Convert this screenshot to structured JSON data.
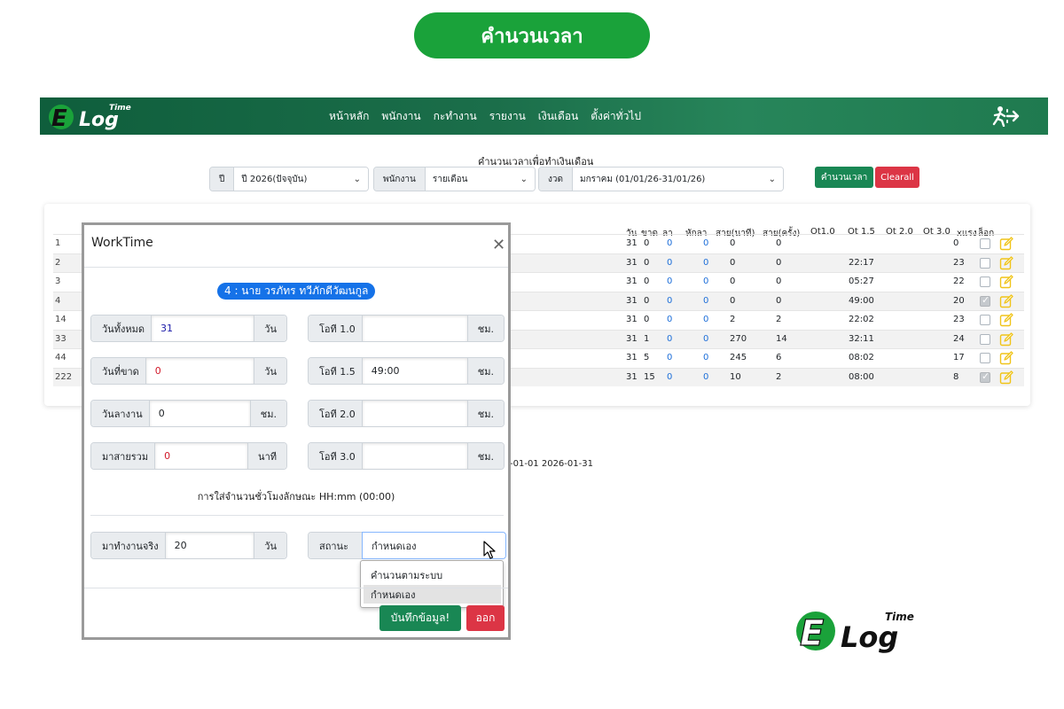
{
  "page_title": "คำนวนเวลา",
  "brand": {
    "logo_text": "Log",
    "logo_super": "Time",
    "colors": {
      "primary": "#1aa23a",
      "nav_bg": "#1b6e4a",
      "danger": "#dc3545",
      "link_blue": "#1e6fd9"
    }
  },
  "nav": {
    "items": [
      "หน้าหลัก",
      "พนักงาน",
      "กะทำงาน",
      "รายงาน",
      "เงินเดือน",
      "ตั้งค่าทั่วไป"
    ],
    "exit_icon": "exit-icon"
  },
  "filters": {
    "heading": "คำนวนเวลาเพื่อทำเงินเดือน",
    "year": {
      "label": "ปี",
      "value": "ปี 2026(ปัจจุบัน)"
    },
    "employee": {
      "label": "พนักงาน",
      "value": "รายเดือน"
    },
    "period": {
      "label": "งวด",
      "value": "มกราคม (01/01/26-31/01/26)"
    },
    "calc_button": "คำนวนเวลา",
    "clear_button": "Clearall"
  },
  "table": {
    "headers": [
      "วัน",
      "ขาด",
      "ลา",
      "หักลา",
      "สาย(นาที)",
      "สาย(ครั้ง)",
      "Ot1.0",
      "Ot 1.5",
      "Ot 2.0",
      "Ot 3.0",
      "xแรง",
      "ล็อก"
    ],
    "rows": [
      {
        "id": "1",
        "days": "31",
        "absent": "0",
        "leave": "0",
        "deduct": "0",
        "late_min": "0",
        "late_count": "0",
        "ot10": "",
        "ot15": "",
        "ot20": "",
        "ot30": "",
        "work": "0",
        "locked": false
      },
      {
        "id": "2",
        "days": "31",
        "absent": "0",
        "leave": "0",
        "deduct": "0",
        "late_min": "0",
        "late_count": "0",
        "ot10": "",
        "ot15": "22:17",
        "ot20": "",
        "ot30": "",
        "work": "23",
        "locked": false
      },
      {
        "id": "3",
        "days": "31",
        "absent": "0",
        "leave": "0",
        "deduct": "0",
        "late_min": "0",
        "late_count": "0",
        "ot10": "",
        "ot15": "05:27",
        "ot20": "",
        "ot30": "",
        "work": "22",
        "locked": false
      },
      {
        "id": "4",
        "days": "31",
        "absent": "0",
        "leave": "0",
        "deduct": "0",
        "late_min": "0",
        "late_count": "0",
        "ot10": "",
        "ot15": "49:00",
        "ot20": "",
        "ot30": "",
        "work": "20",
        "locked": true
      },
      {
        "id": "14",
        "days": "31",
        "absent": "0",
        "leave": "0",
        "deduct": "0",
        "late_min": "2",
        "late_count": "2",
        "ot10": "",
        "ot15": "22:02",
        "ot20": "",
        "ot30": "",
        "work": "23",
        "locked": false
      },
      {
        "id": "33",
        "days": "31",
        "absent": "1",
        "leave": "0",
        "deduct": "0",
        "late_min": "270",
        "late_count": "14",
        "ot10": "",
        "ot15": "32:11",
        "ot20": "",
        "ot30": "",
        "work": "24",
        "locked": false
      },
      {
        "id": "44",
        "days": "31",
        "absent": "5",
        "leave": "0",
        "deduct": "0",
        "late_min": "245",
        "late_count": "6",
        "ot10": "",
        "ot15": "08:02",
        "ot20": "",
        "ot30": "",
        "work": "17",
        "locked": false
      },
      {
        "id": "222",
        "days": "31",
        "absent": "15",
        "leave": "0",
        "deduct": "0",
        "late_min": "10",
        "late_count": "2",
        "ot10": "",
        "ot15": "08:00",
        "ot20": "",
        "ot30": "",
        "work": "8",
        "locked": true
      }
    ],
    "date_range": "-01-01 2026-01-31"
  },
  "modal": {
    "title": "WorkTime",
    "employee": "4 : นาย วรภัทร ทวีภักดีวัฒนกูล",
    "fields": {
      "total_days": {
        "label": "วันทั้งหมด",
        "value": "31",
        "unit": "วัน"
      },
      "absent_days": {
        "label": "วันที่ขาด",
        "value": "0",
        "unit": "วัน"
      },
      "leave_days": {
        "label": "วันลางาน",
        "value": "0",
        "unit": "ชม."
      },
      "late_total": {
        "label": "มาสายรวม",
        "value": "0",
        "unit": "นาที"
      },
      "ot10": {
        "label": "โอที 1.0",
        "value": "",
        "unit": "ชม."
      },
      "ot15": {
        "label": "โอที 1.5",
        "value": "49:00",
        "unit": "ชม."
      },
      "ot20": {
        "label": "โอที 2.0",
        "value": "",
        "unit": "ชม."
      },
      "ot30": {
        "label": "โอที 3.0",
        "value": "",
        "unit": "ชม."
      },
      "actual_work": {
        "label": "มาทำงานจริง",
        "value": "20",
        "unit": "วัน"
      }
    },
    "hint": "การใส่จำนวนชั่วโมงลักษณะ HH:mm (00:00)",
    "status": {
      "label": "สถานะ",
      "value": "กำหนดเอง",
      "options": [
        "คำนวนตามระบบ",
        "กำหนดเอง"
      ]
    },
    "save_button": "บันทึกข้อมูล!",
    "exit_button": "ออก"
  }
}
